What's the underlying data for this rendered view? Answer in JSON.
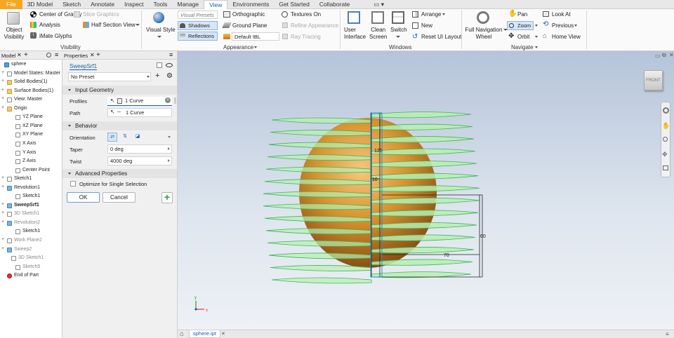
{
  "menu": {
    "tabs": [
      "File",
      "3D Model",
      "Sketch",
      "Annotate",
      "Inspect",
      "Tools",
      "Manage",
      "View",
      "Environments",
      "Get Started",
      "Collaborate"
    ],
    "active_tab": "View"
  },
  "ribbon": {
    "visibility": {
      "object_visibility": "Object\nVisibility",
      "center_of_gravity": "Center of Gravity",
      "slice_graphics": "Slice Graphics",
      "analysis": "Analysis",
      "half_section_view": "Half Section View",
      "imate_glyphs": "iMate Glyphs",
      "group_label": "Visibility"
    },
    "appearance": {
      "visual_style": "Visual Style",
      "visual_presets": "Visual Presets",
      "orthographic": "Orthographic",
      "textures_on": "Textures On",
      "shadows": "Shadows",
      "ground_plane": "Ground Plane",
      "refine_appearance": "Refine Appearance",
      "reflections": "Reflections",
      "default_ibl": "Default IBL",
      "ray_tracing": "Ray Tracing",
      "group_label": "Appearance"
    },
    "windows": {
      "user_interface": "User\nInterface",
      "clean_screen": "Clean\nScreen",
      "switch": "Switch",
      "arrange": "Arrange",
      "new": "New",
      "reset_ui_layout": "Reset UI Layout",
      "group_label": "Windows"
    },
    "navigate": {
      "full_navigation_wheel": "Full Navigation\nWheel",
      "pan": "Pan",
      "zoom": "Zoom",
      "orbit": "Orbit",
      "look_at": "Look At",
      "previous": "Previous",
      "home_view": "Home View",
      "group_label": "Navigate"
    }
  },
  "model_browser": {
    "tab_label": "Model",
    "items": [
      "sphere",
      "Model States: Master",
      "Solid Bodies(1)",
      "Surface Bodies(1)",
      "View: Master",
      "Origin",
      "YZ Plane",
      "XZ Plane",
      "XY Plane",
      "X Axis",
      "Y Axis",
      "Z Axis",
      "Center Point",
      "Sketch1",
      "Revolution1",
      "Sketch1",
      "SweepSrf1",
      "3D Sketch1",
      "Revolution2",
      "Sketch1",
      "Work Plane2",
      "Sweep2",
      "3D Sketch1",
      "Sketch5",
      "End of Part"
    ]
  },
  "properties": {
    "tab_label": "Properties",
    "feature_name": "SweepSrf1",
    "preset": "No Preset",
    "input_geometry": "Input Geometry",
    "profiles_label": "Profiles",
    "profiles_value": "1 Curve",
    "path_label": "Path",
    "path_value": "1 Curve",
    "behavior": "Behavior",
    "orientation_label": "Orientation",
    "taper_label": "Taper",
    "taper_value": "0 deg",
    "twist_label": "Twist",
    "twist_value": "4000 deg",
    "advanced": "Advanced Properties",
    "optimize_label": "Optimize for Single Selection",
    "ok": "OK",
    "cancel": "Cancel"
  },
  "viewport": {
    "viewcube_label": "FRONT",
    "dimensions": [
      "120",
      "10",
      "60",
      "70"
    ],
    "axis_labels": [
      "y",
      "x"
    ]
  },
  "doc_tabs": {
    "active": "sphere.ipt"
  },
  "colors": {
    "file_tab": "#f5a623",
    "active_tab_text": "#1b5fa8",
    "sweep_fill": "#b8efb0",
    "sweep_edge": "#3cb55a",
    "sphere": "#d9932f"
  }
}
